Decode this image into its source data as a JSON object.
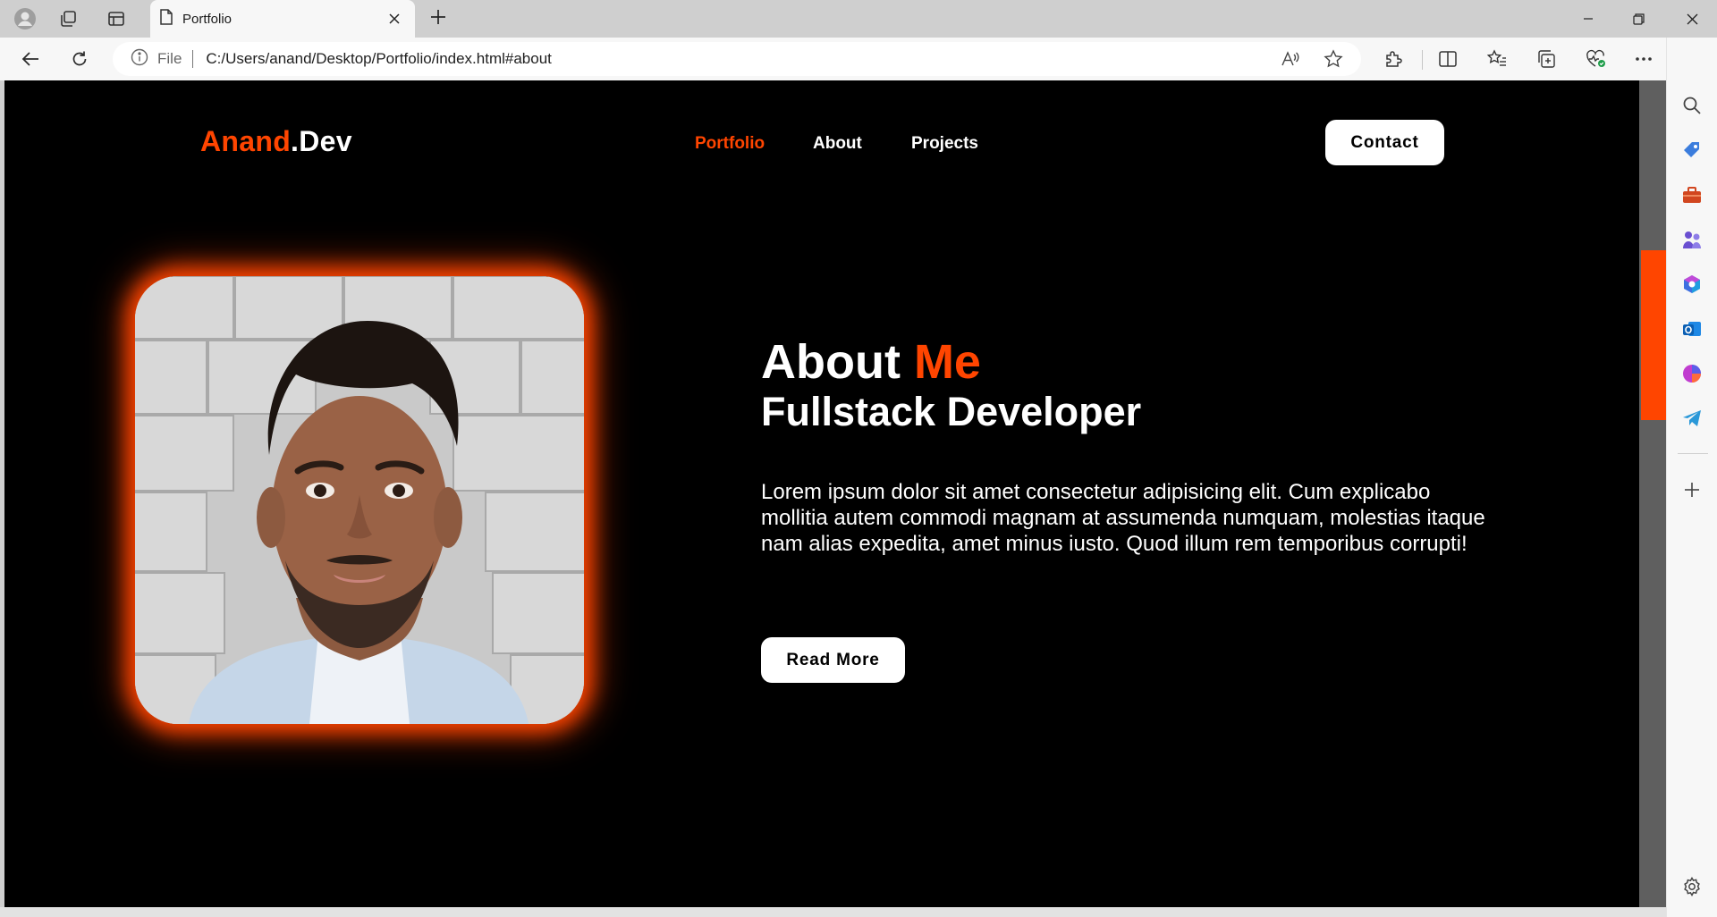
{
  "browser": {
    "tab_title": "Portfolio",
    "address": {
      "scheme_label": "File",
      "url": "C:/Users/anand/Desktop/Portfolio/index.html#about"
    },
    "icons": {
      "profile": "profile-avatar-icon",
      "workspaces": "workspaces-icon",
      "tab_actions": "vertical-tabs-icon",
      "new_tab": "plus-icon",
      "back": "back-arrow-icon",
      "refresh": "refresh-icon",
      "info": "info-icon",
      "read_aloud": "read-aloud-icon",
      "favorite": "star-icon",
      "extensions": "puzzle-icon",
      "split_screen": "split-screen-icon",
      "favorites_list": "favorites-list-icon",
      "collections": "collections-icon",
      "performance": "heart-pulse-icon",
      "more": "more-dots-icon",
      "copilot": "copilot-icon"
    },
    "sidebar_icons": [
      "search-icon",
      "shopping-tag-icon",
      "toolbox-icon",
      "games-icon",
      "microsoft-365-icon",
      "outlook-icon",
      "designer-icon",
      "telegram-icon",
      "add-icon",
      "settings-icon"
    ],
    "colors": {
      "chrome": "#cfcfcf",
      "toolbar": "#f7f7f7",
      "scroll_thumb": "#ff4500"
    }
  },
  "site": {
    "logo_main": "Anand",
    "logo_suffix": ".Dev",
    "nav": [
      {
        "label": "Portfolio",
        "active": true
      },
      {
        "label": "About",
        "active": false
      },
      {
        "label": "Projects",
        "active": false
      }
    ],
    "contact_label": "Contact",
    "about": {
      "heading_plain": "About ",
      "heading_accent": "Me",
      "subtitle": "Fullstack Developer",
      "body": "Lorem ipsum dolor sit amet consectetur adipisicing elit. Cum explicabo mollitia autem commodi magnam at assumenda numquam, molestias itaque nam alias expedita, amet minus iusto. Quod illum rem temporibus corrupti!",
      "read_more_label": "Read More"
    },
    "colors": {
      "accent": "#ff4500",
      "background": "#000000",
      "text": "#ffffff"
    }
  }
}
